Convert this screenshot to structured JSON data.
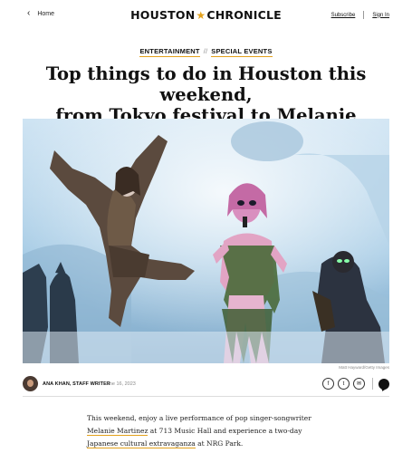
{
  "header": {
    "home_label": "Home",
    "logo_left": "HOUSTON",
    "logo_right": "CHRONICLE",
    "subscribe_label": "Subscribe",
    "signin_label": "Sign In"
  },
  "article": {
    "section_1": "ENTERTAINMENT",
    "section_separator": "//",
    "section_2": "SPECIAL EVENTS",
    "title_line_1": "Top things to do in Houston this weekend,",
    "title_line_2": "from Tokyo festival to Melanie Martinez",
    "photo_credit": "Matt Hayward/Getty Images",
    "author": "ANA KHAN, STAFF WRITER",
    "date": "June 16, 2023",
    "body": {
      "p1_a": "This weekend, enjoy a live performance of pop singer-songwriter ",
      "p1_link1": "Melanie Martinez",
      "p1_b": " at 713 Music Hall and experience a two-day ",
      "p1_link2": "Japanese cultural extravaganza",
      "p1_c": " at NRG Park."
    }
  },
  "share": {
    "icons": [
      "facebook-icon",
      "twitter-icon",
      "email-icon",
      "comment-icon"
    ],
    "facebook_glyph": "f",
    "twitter_glyph": "t",
    "email_glyph": "✉"
  },
  "colors": {
    "accent": "#e3a11b",
    "text": "#111111"
  }
}
